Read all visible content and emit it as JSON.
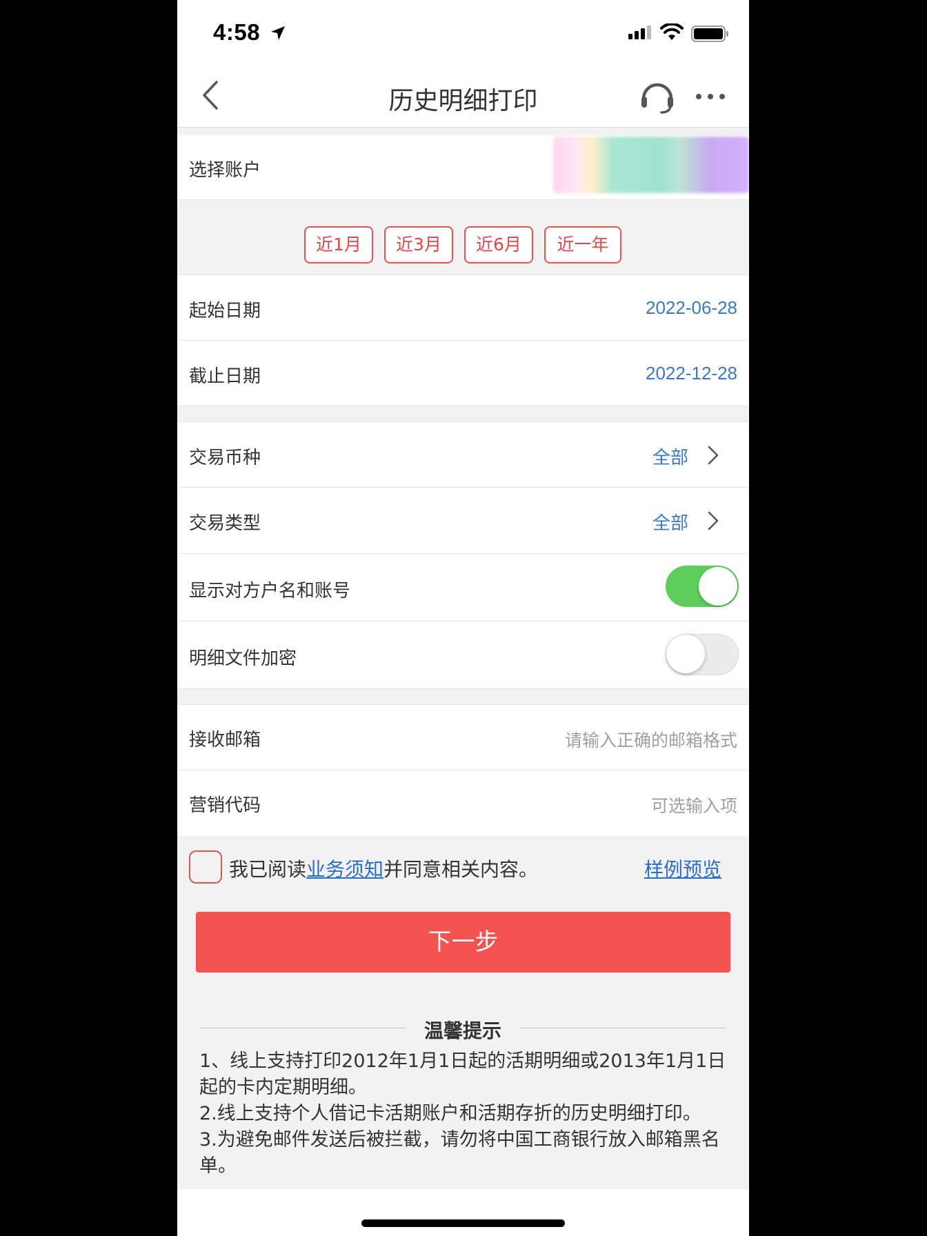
{
  "status_bar": {
    "time": "4:58"
  },
  "nav": {
    "title": "历史明细打印"
  },
  "account": {
    "label": "选择账户"
  },
  "periods": [
    "近1月",
    "近3月",
    "近6月",
    "近一年"
  ],
  "dates": {
    "start_label": "起始日期",
    "start_value": "2022-06-28",
    "end_label": "截止日期",
    "end_value": "2022-12-28"
  },
  "filters": {
    "currency_label": "交易币种",
    "currency_value": "全部",
    "type_label": "交易类型",
    "type_value": "全部"
  },
  "toggles": {
    "show_counterparty_label": "显示对方户名和账号",
    "show_counterparty_on": true,
    "encrypt_label": "明细文件加密",
    "encrypt_on": false
  },
  "inputs": {
    "email_label": "接收邮箱",
    "email_placeholder": "请输入正确的邮箱格式",
    "code_label": "营销代码",
    "code_placeholder": "可选输入项"
  },
  "agreement": {
    "prefix": "我已阅读",
    "link": "业务须知",
    "suffix": "并同意相关内容。",
    "sample": "样例预览"
  },
  "next_button": "下一步",
  "tips": {
    "title": "温馨提示",
    "items": [
      "1、线上支持打印2012年1月1日起的活期明细或2013年1月1日起的卡内定期明细。",
      "2.线上支持个人借记卡活期账户和活期存折的历史明细打印。",
      "3.为避免邮件发送后被拦截，请勿将中国工商银行放入邮箱黑名单。"
    ]
  },
  "colors": {
    "accent_red": "#f55252",
    "link_blue": "#3a78c9",
    "toggle_green": "#5ccf5a"
  }
}
